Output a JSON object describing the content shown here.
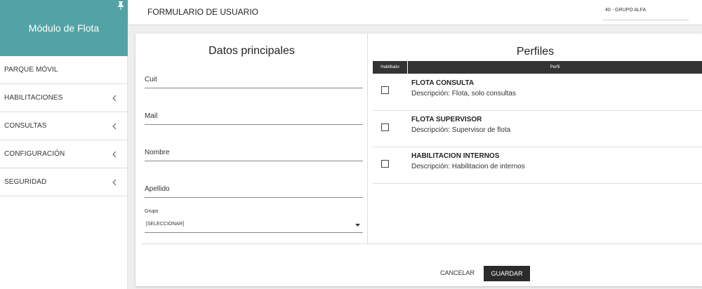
{
  "sidebar": {
    "title": "Módulo de Flota",
    "items": [
      {
        "label": "PARQUE MÓVIL"
      },
      {
        "label": "HABILITACIONES"
      },
      {
        "label": "CONSULTAS"
      },
      {
        "label": "CONFIGURACIÓN"
      },
      {
        "label": "SEGURIDAD"
      }
    ]
  },
  "header": {
    "title": "FORMULARIO DE USUARIO",
    "group_value": "40 - GRUPO ALFA"
  },
  "form": {
    "title": "Datos principales",
    "fields": [
      {
        "label": "Cuit"
      },
      {
        "label": "Mail"
      },
      {
        "label": "Nombre"
      },
      {
        "label": "Apellido"
      }
    ],
    "group": {
      "label": "Grupo",
      "value": "[SELECCIONAR]"
    }
  },
  "profiles": {
    "title": "Perfiles",
    "columns": [
      "Habilitado",
      "Perfil"
    ],
    "rows": [
      {
        "name": "FLOTA CONSULTA",
        "description": "Descripción: Flota, solo consultas",
        "enabled": false
      },
      {
        "name": "FLOTA SUPERVISOR",
        "description": "Descripción: Supervisor de flota",
        "enabled": false
      },
      {
        "name": "HABILITACION INTERNOS",
        "description": "Descripción: Habilitacion de internos",
        "enabled": false
      }
    ]
  },
  "actions": {
    "cancel_label": "CANCELAR",
    "save_label": "GUARDAR"
  },
  "icons": {
    "pin": "pin-icon",
    "chevron": "chevron-left-icon",
    "caret": "caret-down-icon"
  },
  "colors": {
    "brand": "#52a3a6",
    "dark": "#333333"
  }
}
